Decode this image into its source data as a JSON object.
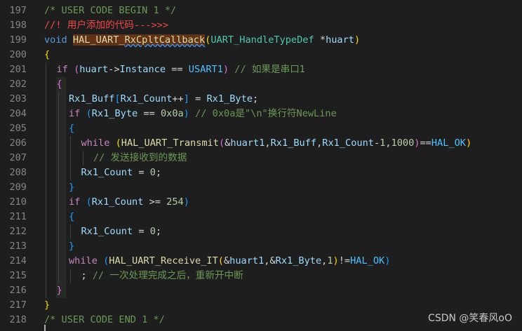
{
  "editor": {
    "lines": [
      {
        "n": "197",
        "indent": 0,
        "tokens": [
          {
            "t": "/* USER CODE BEGIN 1 */",
            "c": "comment"
          }
        ]
      },
      {
        "n": "198",
        "indent": 0,
        "tokens": [
          {
            "t": "//! 用户添加的代码--->>>",
            "c": "red"
          }
        ]
      },
      {
        "n": "199",
        "indent": 0,
        "tokens": [
          {
            "t": "void ",
            "c": "keyword"
          },
          {
            "t": "HAL_UART_",
            "c": "func hl"
          },
          {
            "t": "RxCpltCallback",
            "c": "func hl squig"
          },
          {
            "t": "(",
            "c": "br1"
          },
          {
            "t": "UART_HandleTypeDef",
            "c": "type"
          },
          {
            "t": " *",
            "c": ""
          },
          {
            "t": "huart",
            "c": "var"
          },
          {
            "t": ")",
            "c": "br1"
          }
        ]
      },
      {
        "n": "200",
        "indent": 0,
        "tokens": [
          {
            "t": "{",
            "c": "br1"
          }
        ]
      },
      {
        "n": "201",
        "indent": 1,
        "tokens": [
          {
            "t": "if ",
            "c": "ctrl"
          },
          {
            "t": "(",
            "c": "br2"
          },
          {
            "t": "huart",
            "c": "var"
          },
          {
            "t": "->",
            "c": ""
          },
          {
            "t": "Instance",
            "c": "var"
          },
          {
            "t": " == ",
            "c": ""
          },
          {
            "t": "USART1",
            "c": "const"
          },
          {
            "t": ")",
            "c": "br2"
          },
          {
            "t": " // 如果是串口1",
            "c": "comment"
          }
        ]
      },
      {
        "n": "202",
        "indent": 1,
        "tokens": [
          {
            "t": "{",
            "c": "br2"
          }
        ]
      },
      {
        "n": "203",
        "indent": 2,
        "tokens": [
          {
            "t": "Rx1_Buff",
            "c": "var"
          },
          {
            "t": "[",
            "c": "br3"
          },
          {
            "t": "Rx1_Count",
            "c": "var"
          },
          {
            "t": "++",
            "c": ""
          },
          {
            "t": "]",
            "c": "br3"
          },
          {
            "t": " = ",
            "c": ""
          },
          {
            "t": "Rx1_Byte",
            "c": "var"
          },
          {
            "t": ";",
            "c": ""
          }
        ]
      },
      {
        "n": "204",
        "indent": 2,
        "tokens": [
          {
            "t": "if ",
            "c": "ctrl"
          },
          {
            "t": "(",
            "c": "br3"
          },
          {
            "t": "Rx1_Byte",
            "c": "var"
          },
          {
            "t": " == ",
            "c": ""
          },
          {
            "t": "0x0a",
            "c": "num"
          },
          {
            "t": ")",
            "c": "br3"
          },
          {
            "t": " // 0x0a是\"\\n\"换行符NewLine",
            "c": "comment"
          }
        ]
      },
      {
        "n": "205",
        "indent": 2,
        "tokens": [
          {
            "t": "{",
            "c": "br3"
          }
        ]
      },
      {
        "n": "206",
        "indent": 3,
        "tokens": [
          {
            "t": "while ",
            "c": "ctrl"
          },
          {
            "t": "(",
            "c": "br1"
          },
          {
            "t": "HAL_UART_Transmit",
            "c": "func"
          },
          {
            "t": "(",
            "c": "br2"
          },
          {
            "t": "&",
            "c": ""
          },
          {
            "t": "huart1",
            "c": "var"
          },
          {
            "t": ",",
            "c": ""
          },
          {
            "t": "Rx1_Buff",
            "c": "var"
          },
          {
            "t": ",",
            "c": ""
          },
          {
            "t": "Rx1_Count",
            "c": "var"
          },
          {
            "t": "-",
            "c": ""
          },
          {
            "t": "1",
            "c": "num"
          },
          {
            "t": ",",
            "c": ""
          },
          {
            "t": "1000",
            "c": "num"
          },
          {
            "t": ")",
            "c": "br2"
          },
          {
            "t": "==",
            "c": ""
          },
          {
            "t": "HAL_OK",
            "c": "const"
          },
          {
            "t": ")",
            "c": "br1"
          }
        ]
      },
      {
        "n": "207",
        "indent": 4,
        "tokens": [
          {
            "t": "// 发送接收到的数据",
            "c": "comment"
          }
        ]
      },
      {
        "n": "208",
        "indent": 3,
        "tokens": [
          {
            "t": "Rx1_Count",
            "c": "var"
          },
          {
            "t": " = ",
            "c": ""
          },
          {
            "t": "0",
            "c": "num"
          },
          {
            "t": ";",
            "c": ""
          }
        ]
      },
      {
        "n": "209",
        "indent": 2,
        "tokens": [
          {
            "t": "}",
            "c": "br3"
          }
        ]
      },
      {
        "n": "210",
        "indent": 2,
        "tokens": [
          {
            "t": "if ",
            "c": "ctrl"
          },
          {
            "t": "(",
            "c": "br3"
          },
          {
            "t": "Rx1_Count",
            "c": "var"
          },
          {
            "t": " >= ",
            "c": ""
          },
          {
            "t": "254",
            "c": "num"
          },
          {
            "t": ")",
            "c": "br3"
          }
        ]
      },
      {
        "n": "211",
        "indent": 2,
        "tokens": [
          {
            "t": "{",
            "c": "br3"
          }
        ]
      },
      {
        "n": "212",
        "indent": 3,
        "tokens": [
          {
            "t": "Rx1_Count",
            "c": "var"
          },
          {
            "t": " = ",
            "c": ""
          },
          {
            "t": "0",
            "c": "num"
          },
          {
            "t": ";",
            "c": ""
          }
        ]
      },
      {
        "n": "213",
        "indent": 2,
        "tokens": [
          {
            "t": "}",
            "c": "br3"
          }
        ]
      },
      {
        "n": "214",
        "indent": 2,
        "tokens": [
          {
            "t": "while ",
            "c": "ctrl"
          },
          {
            "t": "(",
            "c": "br3"
          },
          {
            "t": "HAL_UART_Receive_IT",
            "c": "func"
          },
          {
            "t": "(",
            "c": "br1"
          },
          {
            "t": "&",
            "c": ""
          },
          {
            "t": "huart1",
            "c": "var"
          },
          {
            "t": ",&",
            "c": ""
          },
          {
            "t": "Rx1_Byte",
            "c": "var"
          },
          {
            "t": ",",
            "c": ""
          },
          {
            "t": "1",
            "c": "num"
          },
          {
            "t": ")",
            "c": "br1"
          },
          {
            "t": "!=",
            "c": ""
          },
          {
            "t": "HAL_OK",
            "c": "const"
          },
          {
            "t": ")",
            "c": "br3"
          }
        ]
      },
      {
        "n": "215",
        "indent": 3,
        "tokens": [
          {
            "t": "; ",
            "c": ""
          },
          {
            "t": "// 一次处理完成之后，重新开中断",
            "c": "comment"
          }
        ]
      },
      {
        "n": "216",
        "indent": 1,
        "tokens": [
          {
            "t": "}",
            "c": "br2"
          }
        ]
      },
      {
        "n": "217",
        "indent": 0,
        "tokens": [
          {
            "t": "}",
            "c": "br1"
          }
        ]
      },
      {
        "n": "218",
        "indent": 0,
        "tokens": [
          {
            "t": "/* USER CODE END 1 */",
            "c": "comment"
          }
        ]
      }
    ]
  },
  "watermark": "CSDN @笑春风oO"
}
